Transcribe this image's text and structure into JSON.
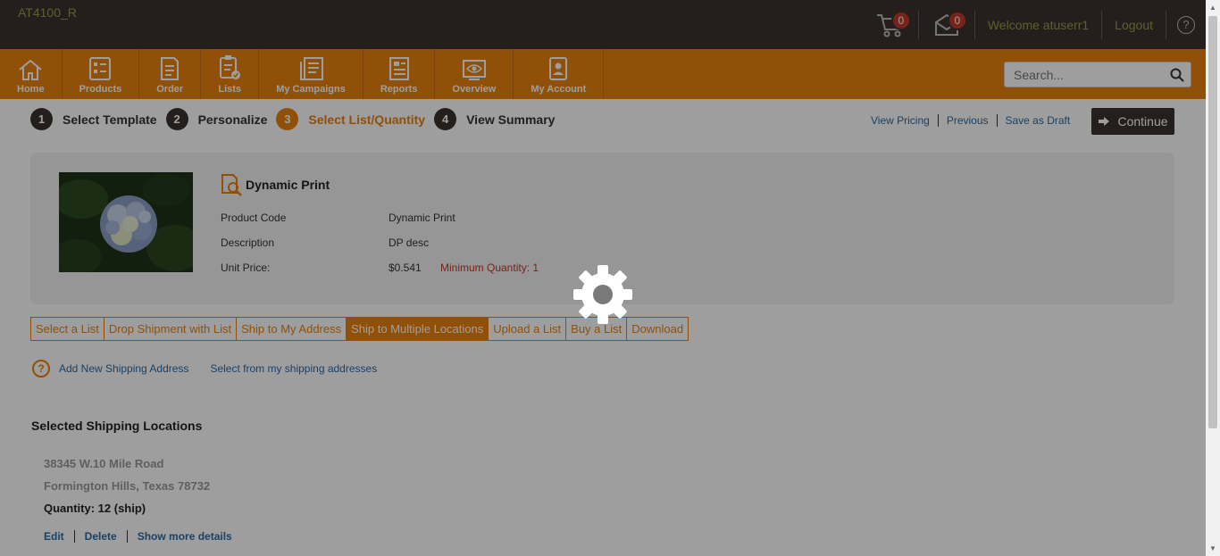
{
  "header": {
    "brand": "AT4100_R",
    "cart_count": "0",
    "messages_count": "0",
    "welcome": "Welcome atuserr1",
    "logout": "Logout",
    "help": "?"
  },
  "nav": {
    "items": [
      {
        "label": "Home",
        "icon": "home-icon"
      },
      {
        "label": "Products",
        "icon": "products-icon"
      },
      {
        "label": "Order",
        "icon": "order-icon"
      },
      {
        "label": "Lists",
        "icon": "lists-icon"
      },
      {
        "label": "My Campaigns",
        "icon": "campaigns-icon"
      },
      {
        "label": "Reports",
        "icon": "reports-icon"
      },
      {
        "label": "Overview",
        "icon": "overview-icon"
      },
      {
        "label": "My Account",
        "icon": "account-icon"
      }
    ],
    "search_placeholder": "Search..."
  },
  "steps": [
    {
      "num": "1",
      "label": "Select Template"
    },
    {
      "num": "2",
      "label": "Personalize"
    },
    {
      "num": "3",
      "label": "Select List/Quantity"
    },
    {
      "num": "4",
      "label": "View Summary"
    }
  ],
  "step_links": {
    "view_pricing": "View Pricing",
    "previous": "Previous",
    "save_draft": "Save as Draft",
    "continue": "Continue"
  },
  "product": {
    "title": "Dynamic Print",
    "code_label": "Product Code",
    "code_value": "Dynamic Print",
    "desc_label": "Description",
    "desc_value": "DP desc",
    "price_label": "Unit Price:",
    "price_value": "$0.541",
    "min_qty": "Minimum Quantity: 1"
  },
  "tabs": [
    "Select a List",
    "Drop Shipment with List",
    "Ship to My Address",
    "Ship to Multiple Locations",
    "Upload a List",
    "Buy a List",
    "Download"
  ],
  "shipping": {
    "help": "?",
    "add_new": "Add New Shipping Address",
    "select_existing": "Select from my shipping addresses",
    "section_title": "Selected Shipping Locations",
    "address_line1": "38345 W.10 Mile Road",
    "address_line2": "Formington Hills, Texas 78732",
    "quantity": "Quantity: 12 (ship)",
    "edit": "Edit",
    "delete": "Delete",
    "more": "Show more details"
  },
  "colors": {
    "topbar": "#3b3330",
    "accent": "#e8820c",
    "link": "#2a6aa5",
    "warning": "#c0392b"
  }
}
